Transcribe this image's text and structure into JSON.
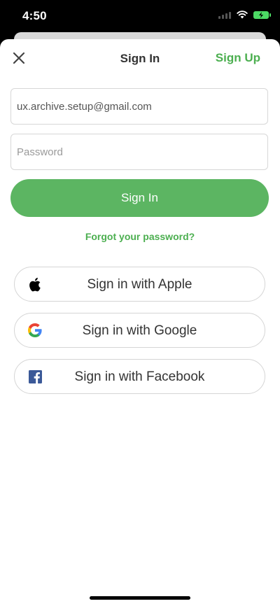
{
  "status_bar": {
    "time": "4:50"
  },
  "nav": {
    "title": "Sign In",
    "signup_label": "Sign Up",
    "close_icon": "close-icon"
  },
  "form": {
    "email_value": "ux.archive.setup@gmail.com",
    "password_placeholder": "Password",
    "signin_label": "Sign In",
    "forgot_label": "Forgot your password?"
  },
  "social": {
    "apple_label": "Sign in with Apple",
    "google_label": "Sign in with Google",
    "facebook_label": "Sign in with Facebook"
  },
  "colors": {
    "accent": "#4caf50",
    "button": "#5cb562",
    "facebook": "#3b5998"
  }
}
